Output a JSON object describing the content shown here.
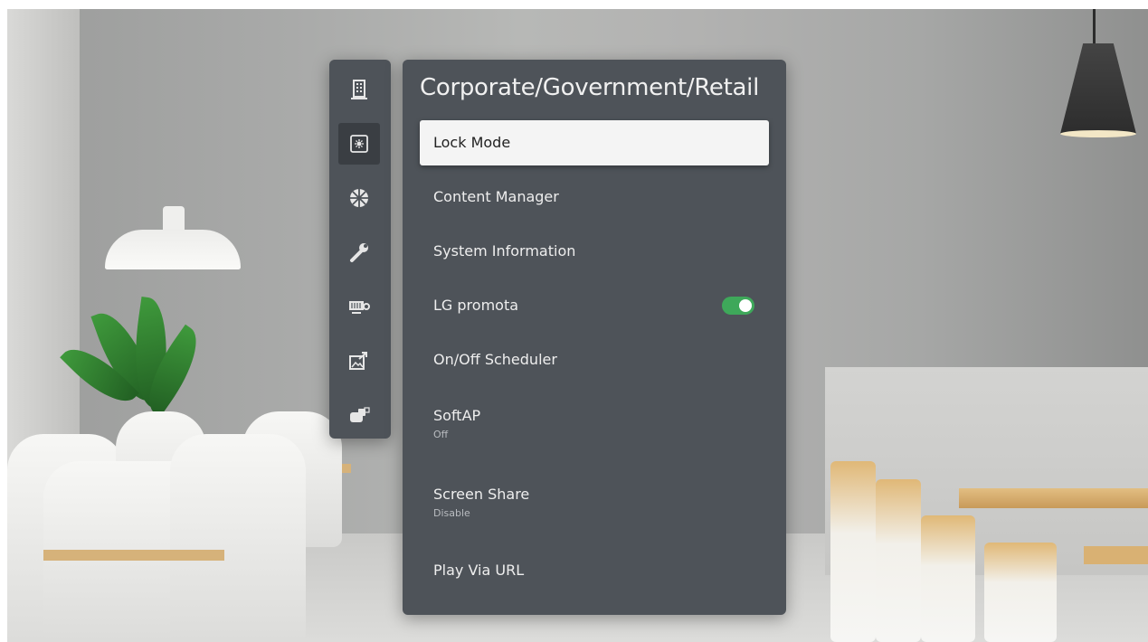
{
  "sidebar": {
    "icons": [
      {
        "name": "building-icon"
      },
      {
        "name": "settings-chip-icon",
        "active": true
      },
      {
        "name": "network-globe-icon"
      },
      {
        "name": "wrench-icon"
      },
      {
        "name": "display-settings-icon"
      },
      {
        "name": "share-image-icon"
      },
      {
        "name": "camera-device-icon"
      }
    ]
  },
  "panel": {
    "title": "Corporate/Government/Retail",
    "items": [
      {
        "label": "Lock Mode",
        "sub": "",
        "focused": true
      },
      {
        "label": "Content Manager",
        "sub": ""
      },
      {
        "label": "System Information",
        "sub": ""
      },
      {
        "label": "LG promota",
        "sub": "",
        "toggle": "on"
      },
      {
        "label": "On/Off Scheduler",
        "sub": ""
      },
      {
        "label": "SoftAP",
        "sub": "Off"
      },
      {
        "label": "Screen Share",
        "sub": "Disable"
      },
      {
        "label": "Play Via URL",
        "sub": ""
      }
    ]
  },
  "colors": {
    "panel_bg": "#4e5359",
    "focus_bg": "#f4f4f4",
    "toggle_on": "#3ea85a"
  }
}
